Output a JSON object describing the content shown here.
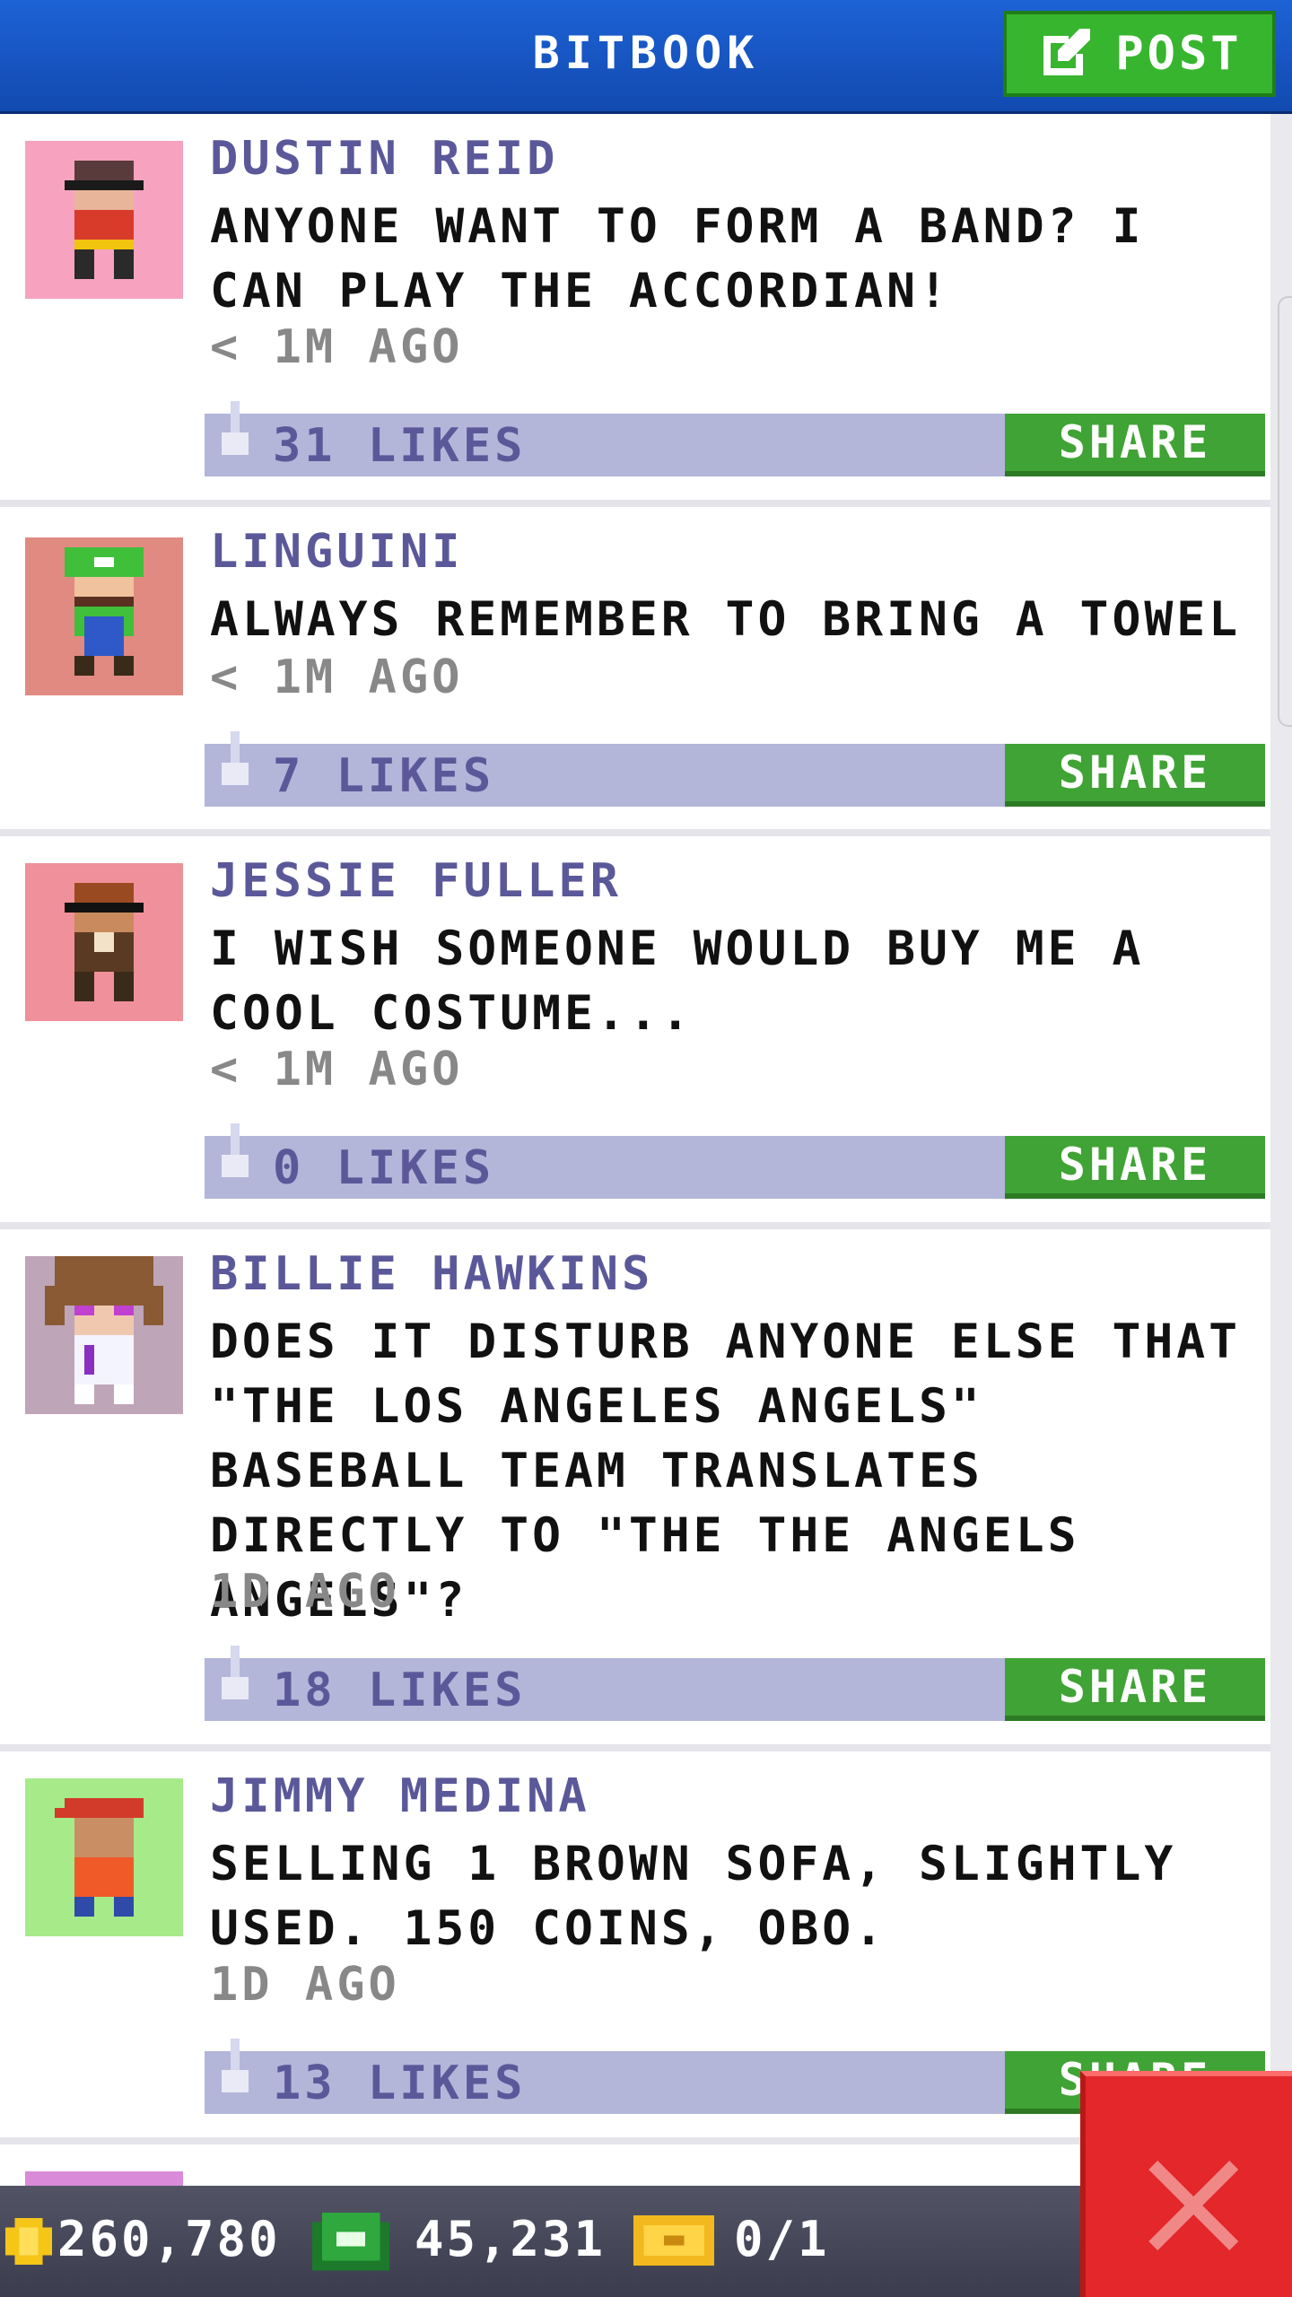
{
  "header": {
    "title": "BITBOOK",
    "post_label": "POST"
  },
  "posts": [
    {
      "author": "DUSTIN REID",
      "message": "ANYONE WANT TO FORM A BAND? I CAN PLAY THE ACCORDIAN!",
      "time": "< 1M AGO",
      "likes": "31 LIKES",
      "share": "SHARE"
    },
    {
      "author": "LINGUINI",
      "message": "ALWAYS REMEMBER TO BRING A TOWEL",
      "time": "< 1M AGO",
      "likes": "7 LIKES",
      "share": "SHARE"
    },
    {
      "author": "JESSIE FULLER",
      "message": "I WISH SOMEONE WOULD BUY ME A COOL COSTUME...",
      "time": "< 1M AGO",
      "likes": "0 LIKES",
      "share": "SHARE"
    },
    {
      "author": "BILLIE HAWKINS",
      "message": "DOES IT DISTURB ANYONE ELSE THAT \"THE LOS ANGELES ANGELS\" BASEBALL TEAM TRANSLATES DIRECTLY TO \"THE THE ANGELS ANGELS\"?",
      "time": "1D AGO",
      "likes": "18 LIKES",
      "share": "SHARE"
    },
    {
      "author": "JIMMY MEDINA",
      "message": "SELLING 1 BROWN SOFA, SLIGHTLY USED. 150 COINS, OBO.",
      "time": "1D AGO",
      "likes": "13 LIKES",
      "share": "SHARE"
    }
  ],
  "currency": {
    "coins": "260,780",
    "bux": "45,231",
    "tickets": "0/1"
  },
  "colors": {
    "header": "#1d62d6",
    "post_button": "#37b52e",
    "share_button": "#40a335",
    "like_bar": "#b3b6d9",
    "author": "#5b589a",
    "close_button": "#e3272a"
  },
  "icons": {
    "post": "edit-icon",
    "like": "thumbs-up-icon",
    "coins": "coin-icon",
    "bux": "bux-icon",
    "tickets": "ticket-icon",
    "close": "close-icon"
  }
}
